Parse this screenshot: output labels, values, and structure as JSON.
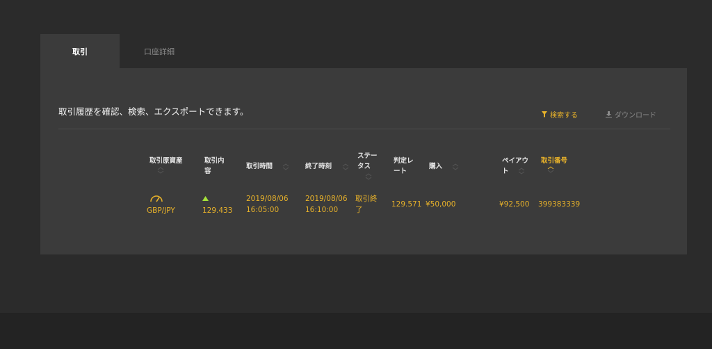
{
  "tabs": [
    {
      "label": "取引",
      "active": true
    },
    {
      "label": "口座詳細",
      "active": false
    }
  ],
  "description": "取引履歴を確認、検索、エクスポートできます。",
  "actions": {
    "search_label": "検索する",
    "download_label": "ダウンロード"
  },
  "columns": {
    "asset": "取引原資産",
    "content_1": "取引内",
    "content_2": "容",
    "trade_time": "取引時間",
    "end_time": "終了時刻",
    "status_1": "ステー",
    "status_2": "タス",
    "rate_1": "判定レ",
    "rate_2": "ート",
    "buy": "購入",
    "payout_1": "ペイアウ",
    "payout_2": "ト",
    "trade_no": "取引番号"
  },
  "rows": [
    {
      "asset": "GBP/JPY",
      "entry_rate": "129.433",
      "trade_date": "2019/08/06",
      "trade_clock": "16:05:00",
      "end_date": "2019/08/06",
      "end_clock": "16:10:00",
      "status_1": "取引終",
      "status_2": "了",
      "judge_rate": "129.571",
      "buy": "¥50,000",
      "payout": "¥92,500",
      "trade_no": "399383339"
    }
  ],
  "colors": {
    "accent": "#e8b22a",
    "up_arrow": "#a6e23a",
    "panel": "#3b3b3b",
    "background": "#2b2b2b"
  },
  "icons": {
    "asset": "gauge-icon",
    "direction": "up-arrow-icon",
    "search": "filter-icon",
    "download": "download-icon",
    "sort": "sort-icon"
  }
}
